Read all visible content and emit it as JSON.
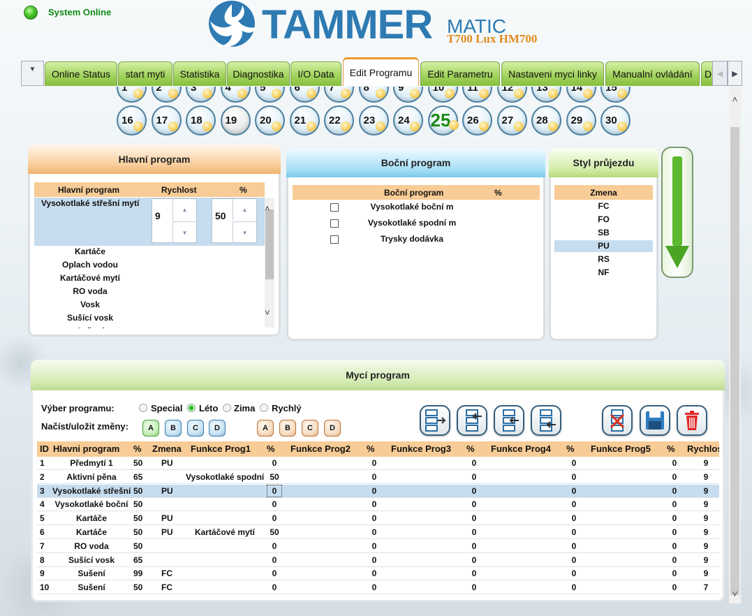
{
  "status": {
    "text": "System Online",
    "led_color": "#3cc01c"
  },
  "logo": {
    "word": "TAMMER",
    "suffix": "MATIC",
    "model": "T700 Lux HM700",
    "brand_color": "#2e7bb3",
    "model_color": "#e08a1e"
  },
  "tabs": [
    "Online Status",
    "start myti",
    "Statistika",
    "Diagnostika",
    "I/O Data",
    "Edit Programu",
    "Edit Parametru",
    "Nastaveni myci linky",
    "Manualní ovládání",
    "D"
  ],
  "active_tab": "Edit Programu",
  "programs": {
    "row1": [
      "1",
      "2",
      "3",
      "4",
      "5",
      "6",
      "7",
      "8",
      "9",
      "10",
      "11",
      "12",
      "13",
      "14",
      "15"
    ],
    "row2": [
      "16",
      "17",
      "18",
      "19",
      "20",
      "21",
      "22",
      "23",
      "24",
      "25",
      "26",
      "27",
      "28",
      "29",
      "30"
    ],
    "selected": "25",
    "plain": "19"
  },
  "hlavni": {
    "title": "Hlavní program",
    "cols": [
      "Hlavní program",
      "Rychlost",
      "%"
    ],
    "selected": {
      "name": "Vysokotlaké střešní mytí",
      "speed": "9",
      "percent": "50"
    },
    "items": [
      "Kartáče",
      "Oplach vodou",
      "Kartáčové mytí",
      "RO voda",
      "Vosk",
      "Sušící vosk",
      "Sušení"
    ]
  },
  "bocni": {
    "title": "Boční program",
    "cols": [
      "Boční program",
      "%"
    ],
    "items": [
      "Vysokotlaké boční m",
      "Vysokotlaké spodní m",
      "Trysky dodávka"
    ]
  },
  "styl": {
    "title": "Styl průjezdu",
    "col": "Zmena",
    "items": [
      "FC",
      "FO",
      "SB",
      "PU",
      "RS",
      "NF"
    ],
    "selected": "PU"
  },
  "myci": {
    "title": "Mycí program",
    "vyber_label": "Výber programu:",
    "options": [
      "Special",
      "Léto",
      "Zima",
      "Rychlý"
    ],
    "selected_option": "Léto",
    "nacist_label": "Načíst/uložit změny:",
    "load_buttons": [
      "A",
      "B",
      "C",
      "D"
    ],
    "save_buttons": [
      "A",
      "B",
      "C",
      "D"
    ],
    "columns": [
      "ID",
      "Hlavni program",
      "%",
      "Zmena",
      "Funkce Prog1",
      "%",
      "Funkce Prog2",
      "%",
      "Funkce Prog3",
      "%",
      "Funkce Prog4",
      "%",
      "Funkce Prog5",
      "%",
      "Rychlost"
    ],
    "rows": [
      [
        "1",
        "Předmytí 1",
        "50",
        "PU",
        "",
        "0",
        "",
        "0",
        "",
        "0",
        "",
        "0",
        "",
        "0",
        "9"
      ],
      [
        "2",
        "Aktivní pěna",
        "65",
        "",
        "Vysokotlaké spodní",
        "50",
        "",
        "0",
        "",
        "0",
        "",
        "0",
        "",
        "0",
        "9"
      ],
      [
        "3",
        "Vysokotlaké střešní",
        "50",
        "PU",
        "",
        "0",
        "",
        "0",
        "",
        "0",
        "",
        "0",
        "",
        "0",
        "9"
      ],
      [
        "4",
        "Vysokotlaké boční",
        "50",
        "",
        "",
        "0",
        "",
        "0",
        "",
        "0",
        "",
        "0",
        "",
        "0",
        "9"
      ],
      [
        "5",
        "Kartáče",
        "50",
        "PU",
        "",
        "0",
        "",
        "0",
        "",
        "0",
        "",
        "0",
        "",
        "0",
        "9"
      ],
      [
        "6",
        "Kartáče",
        "50",
        "PU",
        "Kartáčové mytí",
        "50",
        "",
        "0",
        "",
        "0",
        "",
        "0",
        "",
        "0",
        "9"
      ],
      [
        "7",
        "RO voda",
        "50",
        "",
        "",
        "0",
        "",
        "0",
        "",
        "0",
        "",
        "0",
        "",
        "0",
        "9"
      ],
      [
        "8",
        "Sušící vosk",
        "65",
        "",
        "",
        "0",
        "",
        "0",
        "",
        "0",
        "",
        "0",
        "",
        "0",
        "9"
      ],
      [
        "9",
        "Sušení",
        "99",
        "FC",
        "",
        "0",
        "",
        "0",
        "",
        "0",
        "",
        "0",
        "",
        "0",
        "9"
      ],
      [
        "10",
        "Sušení",
        "50",
        "FC",
        "",
        "0",
        "",
        "0",
        "",
        "0",
        "",
        "0",
        "",
        "0",
        "7"
      ]
    ],
    "selected_row": "3"
  }
}
